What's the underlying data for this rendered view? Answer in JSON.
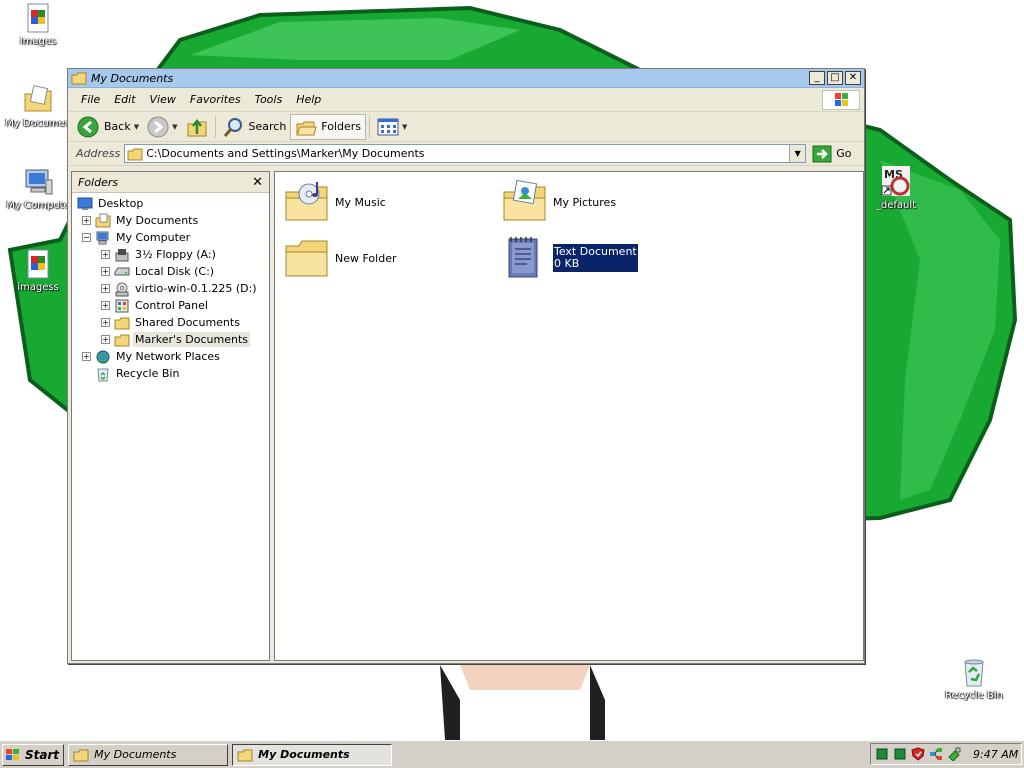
{
  "desktop": {
    "icons": [
      {
        "label": "images",
        "icon": "image-file-icon"
      },
      {
        "label": "My Documen",
        "icon": "my-documents-icon"
      },
      {
        "label": "My Compute",
        "icon": "my-computer-icon"
      },
      {
        "label": "imagess",
        "icon": "image-file-icon"
      },
      {
        "label": "_default",
        "icon": "ms-shortcut-icon"
      },
      {
        "label": "Recycle Bin",
        "icon": "recycle-bin-icon"
      }
    ]
  },
  "window": {
    "title": "My Documents",
    "controls": {
      "minimize": "_",
      "maximize": "□",
      "close": "✕"
    },
    "menu": [
      "File",
      "Edit",
      "View",
      "Favorites",
      "Tools",
      "Help"
    ],
    "toolbar": {
      "back": "Back",
      "search": "Search",
      "folders": "Folders"
    },
    "address": {
      "label": "Address",
      "path": "C:\\Documents and Settings\\Marker\\My Documents",
      "go": "Go"
    },
    "folders_pane": {
      "title": "Folders",
      "close": "✕",
      "tree": [
        {
          "label": "Desktop",
          "level": 0,
          "expander": "",
          "icon": "desktop-icon"
        },
        {
          "label": "My Documents",
          "level": 1,
          "expander": "+",
          "icon": "my-documents-icon"
        },
        {
          "label": "My Computer",
          "level": 1,
          "expander": "−",
          "icon": "my-computer-icon"
        },
        {
          "label": "3½ Floppy (A:)",
          "level": 2,
          "expander": "+",
          "icon": "floppy-drive-icon"
        },
        {
          "label": "Local Disk (C:)",
          "level": 2,
          "expander": "+",
          "icon": "hard-disk-icon"
        },
        {
          "label": "virtio-win-0.1.225 (D:)",
          "level": 2,
          "expander": "+",
          "icon": "cd-drive-icon"
        },
        {
          "label": "Control Panel",
          "level": 2,
          "expander": "+",
          "icon": "control-panel-icon"
        },
        {
          "label": "Shared Documents",
          "level": 2,
          "expander": "+",
          "icon": "folder-icon"
        },
        {
          "label": "Marker's Documents",
          "level": 2,
          "expander": "+",
          "icon": "folder-icon",
          "selected": true
        },
        {
          "label": "My Network Places",
          "level": 1,
          "expander": "+",
          "icon": "network-places-icon"
        },
        {
          "label": "Recycle Bin",
          "level": 1,
          "expander": "",
          "icon": "recycle-bin-icon"
        }
      ]
    },
    "files": [
      {
        "name": "My Music",
        "icon": "music-folder-icon"
      },
      {
        "name": "My Pictures",
        "icon": "pictures-folder-icon"
      },
      {
        "name": "New Folder",
        "icon": "folder-icon"
      },
      {
        "name": "Text Document",
        "size": "0 KB",
        "icon": "text-document-icon",
        "selected": true
      }
    ]
  },
  "taskbar": {
    "start": "Start",
    "tasks": [
      {
        "label": "My Documents",
        "active": false
      },
      {
        "label": "My Documents",
        "active": true
      }
    ],
    "clock": "9:47 AM"
  },
  "colors": {
    "title_bar": "#a6c8ec",
    "selection": "#0a246a",
    "wallpaper_green": "#1bb336",
    "face": "#ece9d8"
  }
}
